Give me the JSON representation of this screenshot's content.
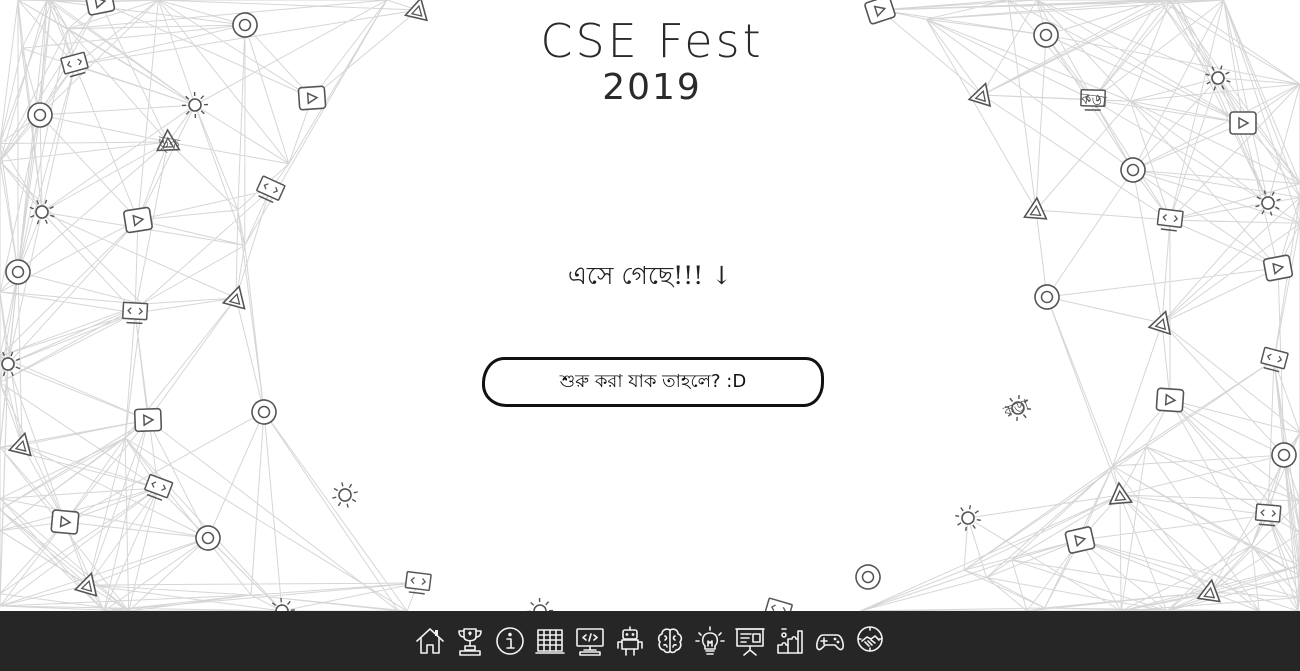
{
  "header": {
    "title": "CSE Fest",
    "year": "2019"
  },
  "main": {
    "tagline": "এসে গেছে!!! ↓",
    "start_button_label": "শুরু করা যাক তাহলে? :D"
  },
  "background": {
    "decor_words": [
      "ভূক",
      "কড়া",
      "কড়া"
    ],
    "line_color": "#d6d6d6",
    "icon_color": "#555555"
  },
  "bottom_nav": {
    "background_color": "#262626",
    "items": [
      {
        "name": "home-icon"
      },
      {
        "name": "trophy-icon"
      },
      {
        "name": "info-icon"
      },
      {
        "name": "schedule-icon"
      },
      {
        "name": "coding-monitor-icon"
      },
      {
        "name": "robot-icon"
      },
      {
        "name": "brain-icon"
      },
      {
        "name": "lightbulb-icon"
      },
      {
        "name": "presentation-icon"
      },
      {
        "name": "puzzle-icon"
      },
      {
        "name": "gamepad-icon"
      },
      {
        "name": "sponsor-handshake-icon"
      }
    ]
  }
}
